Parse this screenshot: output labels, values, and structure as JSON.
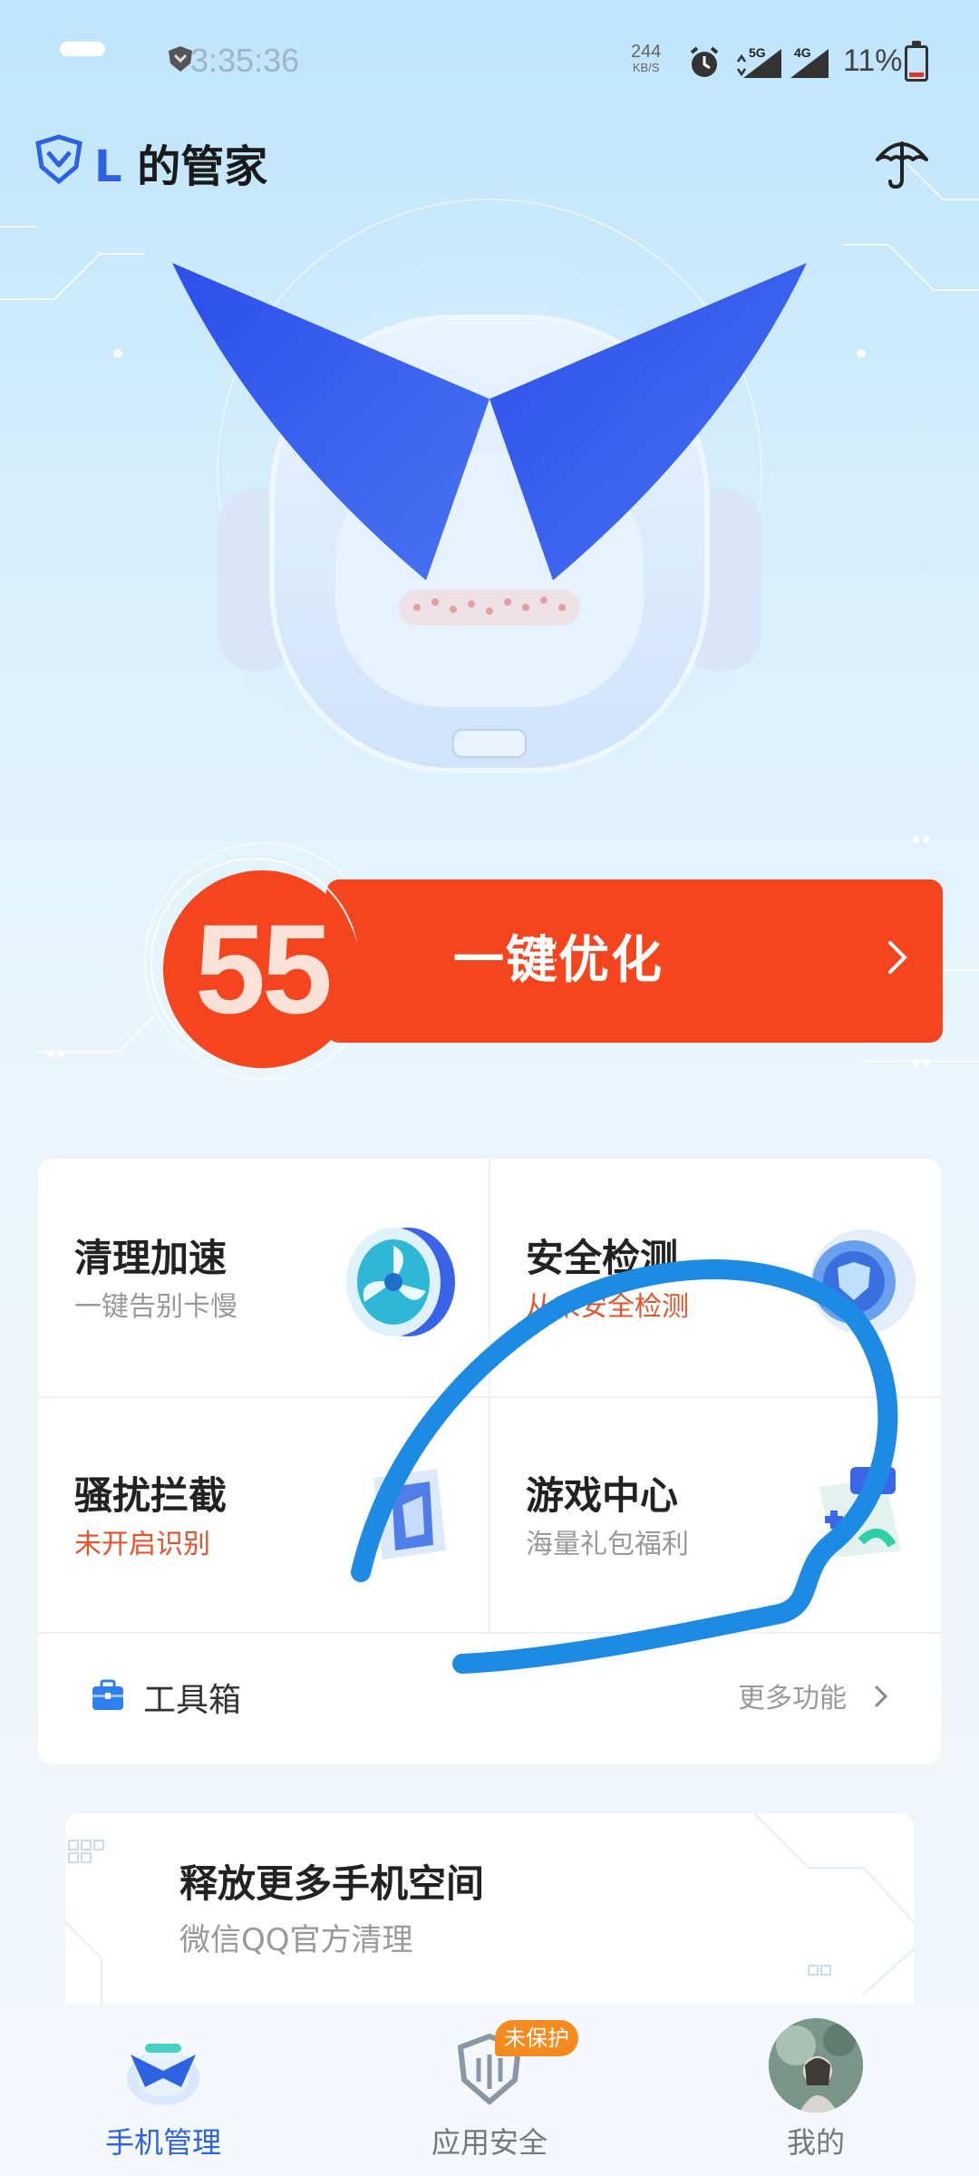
{
  "status_bar": {
    "time": "3:35:36",
    "net_speed": "244",
    "net_speed_unit": "KB/S",
    "sig1_label": "5G",
    "sig2_label": "4G",
    "battery_percent": "11%"
  },
  "header": {
    "title_prefix": "L",
    "title_suffix": " 的管家"
  },
  "score": {
    "value": "55",
    "optimize_label": "一键优化"
  },
  "features": [
    {
      "title": "清理加速",
      "subtitle": "一键告别卡慢",
      "subtitle_warn": false
    },
    {
      "title": "安全检测",
      "subtitle": "从未安全检测",
      "subtitle_warn": true
    },
    {
      "title": "骚扰拦截",
      "subtitle": "未开启识别",
      "subtitle_warn": true
    },
    {
      "title": "游戏中心",
      "subtitle": "海量礼包福利",
      "subtitle_warn": false
    }
  ],
  "toolbox": {
    "label": "工具箱",
    "more_label": "更多功能"
  },
  "promo": {
    "title": "释放更多手机空间",
    "subtitle": "微信QQ官方清理"
  },
  "bottom_nav": [
    {
      "label": "手机管理",
      "active": true
    },
    {
      "label": "应用安全",
      "active": false,
      "badge": "未保护"
    },
    {
      "label": "我的",
      "active": false
    }
  ],
  "colors": {
    "accent_blue": "#2d63e2",
    "optimize_red": "#f4451f",
    "warn_orange": "#e8522a",
    "badge_orange": "#f58a1f",
    "scribble_blue": "#1d8be3"
  }
}
